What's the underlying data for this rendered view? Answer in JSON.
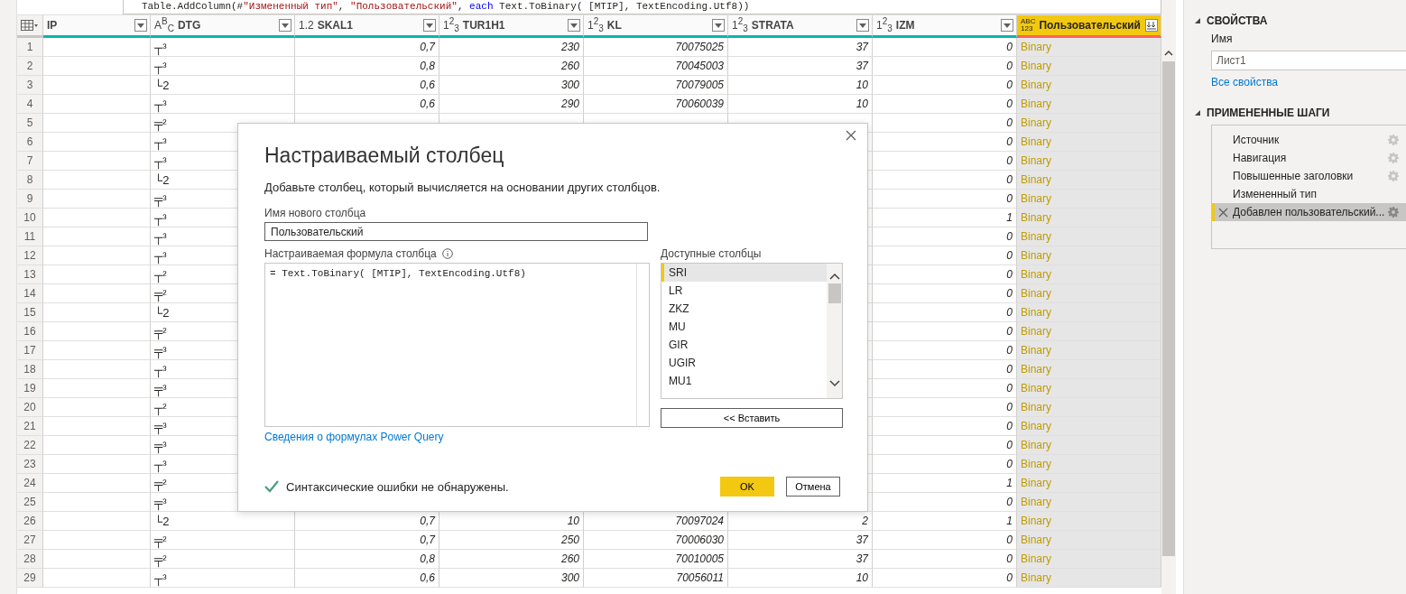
{
  "formula_bar": {
    "parts": [
      {
        "text": "Table.AddColumn(#",
        "kind": "code"
      },
      {
        "text": "\"Измененный тип\"",
        "kind": "string"
      },
      {
        "text": ", ",
        "kind": "code"
      },
      {
        "text": "\"Пользовательский\"",
        "kind": "string"
      },
      {
        "text": ", ",
        "kind": "code"
      },
      {
        "text": "each",
        "kind": "keyword"
      },
      {
        "text": " Text.ToBinary( [MTIP], TextEncoding.Utf8))",
        "kind": "code"
      }
    ]
  },
  "columns": [
    {
      "title": "IP",
      "kind": "text",
      "color": "#01b8aa",
      "selected": false
    },
    {
      "title": "DTG",
      "type_label": "A$^{B}$$_{C}$",
      "kind": "text",
      "color": "#01b8aa",
      "selected": false
    },
    {
      "title": "SKAL1",
      "type_label": "1.2",
      "kind": "number",
      "color": "#01b8aa",
      "selected": false
    },
    {
      "title": "TUR1H1",
      "type_label": "1$^{2}$$_{3}$",
      "kind": "number",
      "color": "#01b8aa",
      "selected": false
    },
    {
      "title": "KL",
      "type_label": "1$^{2}$$_{3}$",
      "kind": "number",
      "color": "#01b8aa",
      "selected": false
    },
    {
      "title": "STRATA",
      "type_label": "1$^{2}$$_{3}$",
      "kind": "number",
      "color": "#01b8aa",
      "selected": false
    },
    {
      "title": "IZM",
      "type_label": "1$^{2}$$_{3}$",
      "kind": "number",
      "color": "#01b8aa",
      "selected": false
    },
    {
      "title": "Пользовательский",
      "type_label": "ABC",
      "type_label_2": "123",
      "kind": "binary",
      "color": "#fd625e",
      "selected": true
    }
  ],
  "rows": [
    {
      "number": "1",
      "cells": [
        null,
        "┬³",
        "0,7",
        "230",
        "70075025",
        "37",
        "0",
        "Binary"
      ]
    },
    {
      "number": "2",
      "cells": [
        null,
        "┬³",
        "0,8",
        "260",
        "70045003",
        "37",
        "0",
        "Binary"
      ]
    },
    {
      "number": "3",
      "cells": [
        null,
        "└2",
        "0,6",
        "300",
        "70079005",
        "10",
        "0",
        "Binary"
      ]
    },
    {
      "number": "4",
      "cells": [
        null,
        "┬³",
        "0,6",
        "290",
        "70060039",
        "10",
        "0",
        "Binary"
      ]
    },
    {
      "number": "5",
      "cells": [
        null,
        "╤²",
        null,
        null,
        null,
        null,
        "0",
        "Binary"
      ]
    },
    {
      "number": "6",
      "cells": [
        null,
        "┬³",
        null,
        null,
        null,
        null,
        "0",
        "Binary"
      ]
    },
    {
      "number": "7",
      "cells": [
        null,
        "┬³",
        null,
        null,
        null,
        null,
        "0",
        "Binary"
      ]
    },
    {
      "number": "8",
      "cells": [
        null,
        "└2",
        null,
        null,
        null,
        null,
        "0",
        "Binary"
      ]
    },
    {
      "number": "9",
      "cells": [
        null,
        "╤³",
        null,
        null,
        null,
        null,
        "0",
        "Binary"
      ]
    },
    {
      "number": "10",
      "cells": [
        null,
        "┬³",
        null,
        null,
        null,
        null,
        "1",
        "Binary"
      ]
    },
    {
      "number": "11",
      "cells": [
        null,
        "┬³",
        null,
        null,
        null,
        null,
        "0",
        "Binary"
      ]
    },
    {
      "number": "12",
      "cells": [
        null,
        "┬³",
        null,
        null,
        null,
        null,
        "0",
        "Binary"
      ]
    },
    {
      "number": "13",
      "cells": [
        null,
        "┬²",
        null,
        null,
        null,
        null,
        "0",
        "Binary"
      ]
    },
    {
      "number": "14",
      "cells": [
        null,
        "╤²",
        null,
        null,
        null,
        null,
        "0",
        "Binary"
      ]
    },
    {
      "number": "15",
      "cells": [
        null,
        "└2",
        null,
        null,
        null,
        null,
        "0",
        "Binary"
      ]
    },
    {
      "number": "16",
      "cells": [
        null,
        "╤²",
        null,
        null,
        null,
        null,
        "0",
        "Binary"
      ]
    },
    {
      "number": "17",
      "cells": [
        null,
        "╤³",
        null,
        null,
        null,
        null,
        "0",
        "Binary"
      ]
    },
    {
      "number": "18",
      "cells": [
        null,
        "┬³",
        null,
        null,
        null,
        null,
        "0",
        "Binary"
      ]
    },
    {
      "number": "19",
      "cells": [
        null,
        "╤³",
        null,
        null,
        null,
        null,
        "0",
        "Binary"
      ]
    },
    {
      "number": "20",
      "cells": [
        null,
        "┬²",
        null,
        null,
        null,
        null,
        "0",
        "Binary"
      ]
    },
    {
      "number": "21",
      "cells": [
        null,
        "╤³",
        null,
        null,
        null,
        null,
        "0",
        "Binary"
      ]
    },
    {
      "number": "22",
      "cells": [
        null,
        "╤³",
        null,
        null,
        null,
        null,
        "0",
        "Binary"
      ]
    },
    {
      "number": "23",
      "cells": [
        null,
        "┬³",
        null,
        null,
        null,
        null,
        "0",
        "Binary"
      ]
    },
    {
      "number": "24",
      "cells": [
        null,
        "╤²",
        null,
        null,
        null,
        null,
        "1",
        "Binary"
      ]
    },
    {
      "number": "25",
      "cells": [
        null,
        "╤³",
        null,
        null,
        null,
        null,
        "0",
        "Binary"
      ]
    },
    {
      "number": "26",
      "cells": [
        null,
        "└2",
        "0,7",
        "10",
        "70097024",
        "2",
        "1",
        "Binary"
      ]
    },
    {
      "number": "27",
      "cells": [
        null,
        "╤²",
        "0,7",
        "250",
        "70006030",
        "37",
        "0",
        "Binary"
      ]
    },
    {
      "number": "28",
      "cells": [
        null,
        "╤²",
        "0,8",
        "260",
        "70010005",
        "37",
        "0",
        "Binary"
      ]
    },
    {
      "number": "29",
      "cells": [
        null,
        "┬³",
        "0,6",
        "300",
        "70056011",
        "10",
        "0",
        "Binary"
      ]
    }
  ],
  "dialog": {
    "title": "Настраиваемый столбец",
    "description": "Добавьте столбец, который вычисляется на основании других столбцов.",
    "name_label": "Имя нового столбца",
    "name_value": "Пользовательский",
    "formula_label": "Настраиваемая формула столбца",
    "formula_value": "= Text.ToBinary( [MTIP], TextEncoding.Utf8)",
    "available_label": "Доступные столбцы",
    "available_columns": [
      {
        "label": "SRI",
        "selected": true
      },
      {
        "label": "LR",
        "selected": false
      },
      {
        "label": "ZKZ",
        "selected": false
      },
      {
        "label": "MU",
        "selected": false
      },
      {
        "label": "GIR",
        "selected": false
      },
      {
        "label": "UGIR",
        "selected": false
      },
      {
        "label": "MU1",
        "selected": false
      }
    ],
    "insert_button": "<< Вставить",
    "help_link": "Сведения о формулах Power Query",
    "status": "Синтаксические ошибки не обнаружены.",
    "ok_button": "OK",
    "cancel_button": "Отмена"
  },
  "properties": {
    "title": "СВОЙСТВА",
    "name_label": "Имя",
    "name_value": "Лист1",
    "all_properties_link": "Все свойства"
  },
  "applied_steps": {
    "title": "ПРИМЕНЕННЫЕ ШАГИ",
    "steps": [
      {
        "label": "Источник",
        "has_settings": true,
        "selected": false
      },
      {
        "label": "Навигация",
        "has_settings": true,
        "selected": false
      },
      {
        "label": "Повышенные заголовки",
        "has_settings": true,
        "selected": false
      },
      {
        "label": "Измененный тип",
        "has_settings": false,
        "selected": false
      },
      {
        "label": "Добавлен пользовательский...",
        "has_settings": true,
        "selected": true
      }
    ]
  }
}
